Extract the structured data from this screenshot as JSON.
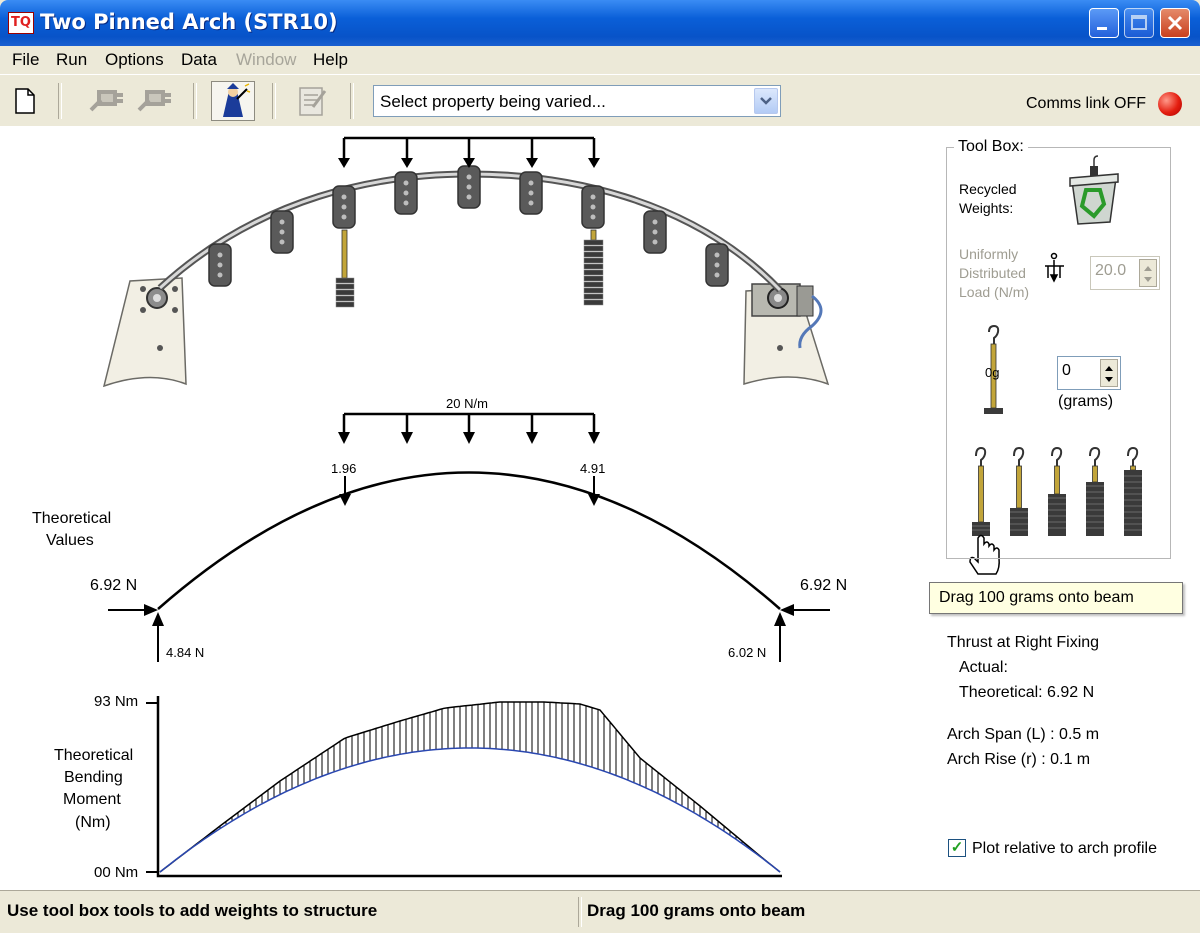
{
  "window": {
    "title": "Two Pinned Arch (STR10)",
    "app_icon": "app-logo-icon"
  },
  "menu": [
    "File",
    "Run",
    "Options",
    "Data",
    "Window",
    "Help"
  ],
  "menu_disabled": [
    "Window"
  ],
  "toolbar": {
    "property_select": "Select property being varied...",
    "comms_label": "Comms link OFF",
    "comms_color": "#e41e10"
  },
  "diagram": {
    "load_label": "20 N/m",
    "left_load": "1.96",
    "right_load": "4.91",
    "theoretical_label_1": "Theoretical",
    "theoretical_label_2": "Values",
    "left_thrust": "6.92 N",
    "right_thrust": "6.92 N",
    "left_reaction": "4.84 N",
    "right_reaction": "6.02 N"
  },
  "bm_chart": {
    "max_label": "93 Nm",
    "min_label": "00 Nm",
    "label_1": "Theoretical",
    "label_2": "Bending",
    "label_3": "Moment",
    "label_4": "(Nm)"
  },
  "toolbox": {
    "title": "Tool Box:",
    "recycled_1": "Recycled",
    "recycled_2": "Weights:",
    "udl_1": "Uniformly",
    "udl_2": "Distributed",
    "udl_3": "Load (N/m)",
    "udl_value": "20.0",
    "weight_label": "0g",
    "grams_value": "0",
    "grams_unit": "(grams)"
  },
  "tooltip": "Drag 100 grams onto beam",
  "info": {
    "thrust_title": "Thrust at Right Fixing",
    "actual": "Actual:",
    "theoretical": "Theoretical: 6.92 N",
    "span": "Arch Span (L) : 0.5 m",
    "rise": "Arch Rise (r) : 0.1 m",
    "plot_relative": "Plot relative to arch profile"
  },
  "status": {
    "left": "Use tool box tools to add weights to structure",
    "right": "Drag 100 grams onto beam"
  }
}
